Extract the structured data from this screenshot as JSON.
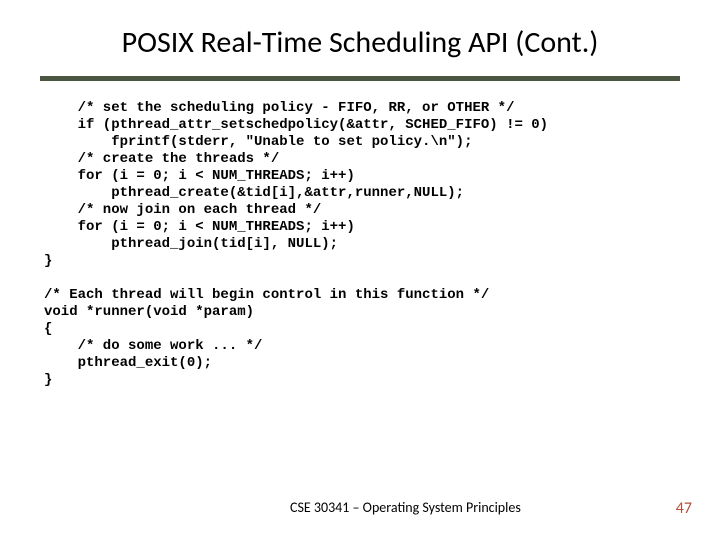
{
  "title": "POSIX Real-Time Scheduling API (Cont.)",
  "code": {
    "l1": "    /* set the scheduling policy - FIFO, RR, or OTHER */",
    "l2": "    if (pthread_attr_setschedpolicy(&attr, SCHED_FIFO) != 0)",
    "l3": "        fprintf(stderr, \"Unable to set policy.\\n\");",
    "l4": "    /* create the threads */",
    "l5": "    for (i = 0; i < NUM_THREADS; i++)",
    "l6": "        pthread_create(&tid[i],&attr,runner,NULL);",
    "l7": "    /* now join on each thread */",
    "l8": "    for (i = 0; i < NUM_THREADS; i++)",
    "l9": "        pthread_join(tid[i], NULL);",
    "l10": "}",
    "l11": "",
    "l12": "/* Each thread will begin control in this function */",
    "l13": "void *runner(void *param)",
    "l14": "{",
    "l15": "    /* do some work ... */",
    "l16": "    pthread_exit(0);",
    "l17": "}"
  },
  "footer": "CSE 30341 – Operating System Principles",
  "page": "47"
}
